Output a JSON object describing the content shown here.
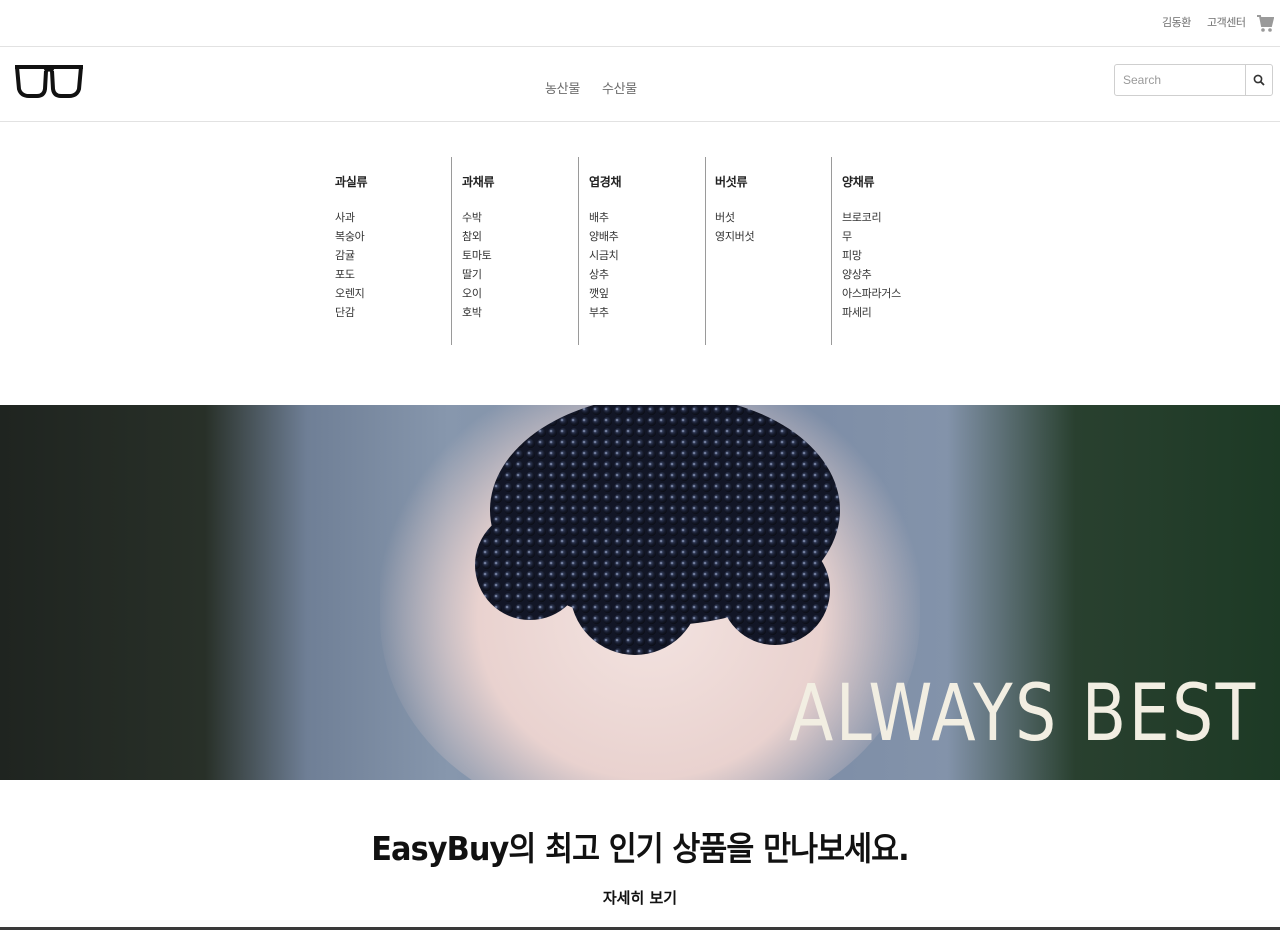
{
  "topbar": {
    "user_label": "김동환",
    "customer_center_label": "고객센터",
    "cart_icon": "cart-icon"
  },
  "header": {
    "logo_icon": "glasses-icon",
    "nav": [
      "농산물",
      "수산물"
    ],
    "search": {
      "placeholder": "Search",
      "value": "",
      "button_icon": "search-icon"
    }
  },
  "mega_menu": {
    "columns": [
      {
        "title": "과실류",
        "items": [
          "사과",
          "복숭아",
          "감귤",
          "포도",
          "오렌지",
          "단감"
        ]
      },
      {
        "title": "과채류",
        "items": [
          "수박",
          "참외",
          "토마토",
          "딸기",
          "오이",
          "호박"
        ]
      },
      {
        "title": "엽경채",
        "items": [
          "배추",
          "양배추",
          "시금치",
          "상추",
          "깻잎",
          "부추"
        ]
      },
      {
        "title": "버섯류",
        "items": [
          "버섯",
          "영지버섯"
        ]
      },
      {
        "title": "양채류",
        "items": [
          "브로코리",
          "무",
          "피망",
          "양상추",
          "아스파라거스",
          "파세리"
        ]
      }
    ]
  },
  "hero": {
    "tagline": "ALWAYS BEST"
  },
  "promo": {
    "title": "EasyBuy의 최고 인기 상품을 만나보세요.",
    "link_label": "자세히 보기"
  },
  "colors": {
    "text": "#222222",
    "muted": "#6e6e6e",
    "divider": "#e2e2e2",
    "tagline": "#f2eee2"
  }
}
